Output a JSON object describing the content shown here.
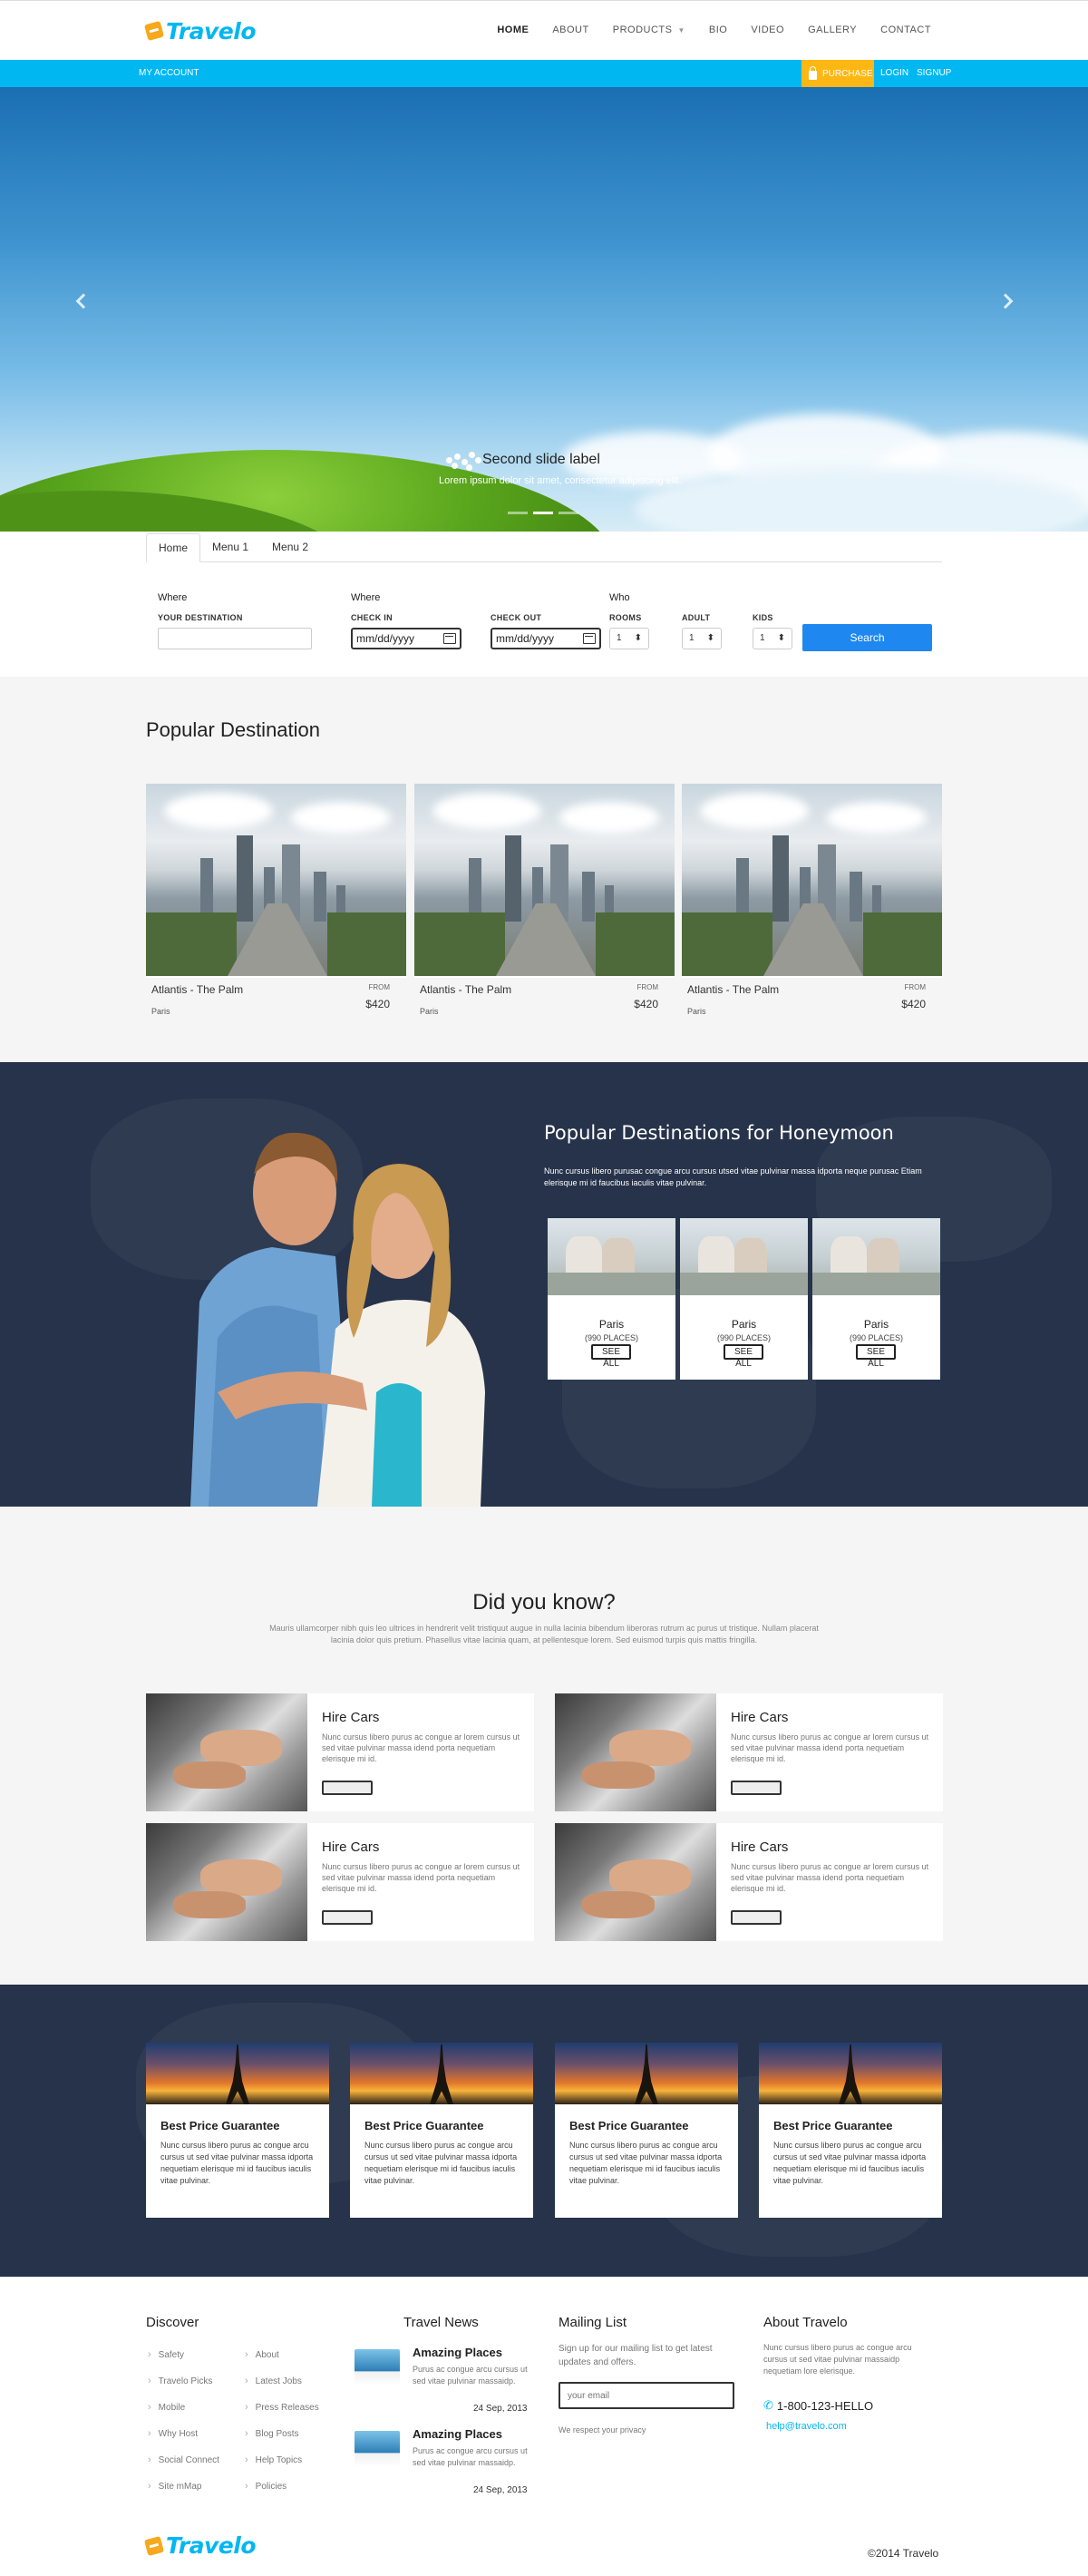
{
  "brand": {
    "name": "Travelo",
    "accent": "#01b7f2",
    "orange": "#fdb714"
  },
  "nav": {
    "items": [
      "HOME",
      "ABOUT",
      "PRODUCTS",
      "BIO",
      "VIDEO",
      "GALLERY",
      "CONTACT"
    ]
  },
  "topbar": {
    "account": "MY ACCOUNT",
    "purchase": "PURCHASE",
    "login": "LOGIN",
    "signup": "SIGNUP"
  },
  "hero": {
    "label": "Second slide label",
    "caption": "Lorem ipsum dolor sit amet, consectetur adipiscing elit.",
    "slides": 3,
    "active_slide": 2
  },
  "tabs": [
    "Home",
    "Menu 1",
    "Menu 2"
  ],
  "search": {
    "where1": "Where",
    "destination_label": "YOUR DESTINATION",
    "where2": "Where",
    "checkin_label": "CHECK IN",
    "checkout_label": "CHECK OUT",
    "date_placeholder": "mm/dd/yyyy",
    "who": "Who",
    "rooms_label": "ROOMS",
    "adult_label": "ADULT",
    "kids_label": "KIDS",
    "rooms": "1",
    "adult": "1",
    "kids": "1",
    "button": "Search"
  },
  "popular": {
    "title": "Popular Destination",
    "cards": [
      {
        "name": "Atlantis - The Palm",
        "from": "FROM",
        "price": "$420",
        "location": "Paris"
      },
      {
        "name": "Atlantis - The Palm",
        "from": "FROM",
        "price": "$420",
        "location": "Paris"
      },
      {
        "name": "Atlantis - The Palm",
        "from": "FROM",
        "price": "$420",
        "location": "Paris"
      }
    ]
  },
  "honeymoon": {
    "title": "Popular Destinations for Honeymoon",
    "description": "Nunc cursus libero purusac congue arcu cursus utsed vitae pulvinar massa idporta neque purusac Etiam elerisque mi id faucibus iaculis vitae pulvinar.",
    "cards": [
      {
        "city": "Paris",
        "places": "(990 PLACES)",
        "button": "SEE ALL"
      },
      {
        "city": "Paris",
        "places": "(990 PLACES)",
        "button": "SEE ALL"
      },
      {
        "city": "Paris",
        "places": "(990 PLACES)",
        "button": "SEE ALL"
      }
    ]
  },
  "didyouknow": {
    "title": "Did you know?",
    "description": "Mauris ullamcorper nibh quis leo ultrices in hendrerit velit tristiquut augue in nulla lacinia bibendum liberoras rutrum ac purus ut tristique. Nullam placerat lacinia dolor quis pretium. Phasellus vitae lacinia quam, at pellentesque lorem. Sed euismod turpis quis mattis fringilla.",
    "items": [
      {
        "title": "Hire Cars",
        "text": "Nunc cursus libero purus ac congue ar lorem cursus ut sed vitae pulvinar massa idend porta nequetiam elerisque mi id."
      },
      {
        "title": "Hire Cars",
        "text": "Nunc cursus libero purus ac congue ar lorem cursus ut sed vitae pulvinar massa idend porta nequetiam elerisque mi id."
      },
      {
        "title": "Hire Cars",
        "text": "Nunc cursus libero purus ac congue ar lorem cursus ut sed vitae pulvinar massa idend porta nequetiam elerisque mi id."
      },
      {
        "title": "Hire Cars",
        "text": "Nunc cursus libero purus ac congue ar lorem cursus ut sed vitae pulvinar massa idend porta nequetiam elerisque mi id."
      }
    ]
  },
  "best": {
    "cards": [
      {
        "title": "Best Price Guarantee",
        "text": "Nunc cursus libero purus ac congue arcu cursus ut sed vitae pulvinar massa idporta nequetiam elerisque mi id faucibus iaculis vitae pulvinar."
      },
      {
        "title": "Best Price Guarantee",
        "text": "Nunc cursus libero purus ac congue arcu cursus ut sed vitae pulvinar massa idporta nequetiam elerisque mi id faucibus iaculis vitae pulvinar."
      },
      {
        "title": "Best Price Guarantee",
        "text": "Nunc cursus libero purus ac congue arcu cursus ut sed vitae pulvinar massa idporta nequetiam elerisque mi id faucibus iaculis vitae pulvinar."
      },
      {
        "title": "Best Price Guarantee",
        "text": "Nunc cursus libero purus ac congue arcu cursus ut sed vitae pulvinar massa idporta nequetiam elerisque mi id faucibus iaculis vitae pulvinar."
      }
    ]
  },
  "footer": {
    "discover": {
      "title": "Discover",
      "col1": [
        "Safety",
        "Travelo Picks",
        "Mobile",
        "Why Host",
        "Social Connect",
        "Site mMap"
      ],
      "col2": [
        "About",
        "Latest Jobs",
        "Press Releases",
        "Blog Posts",
        "Help Topics",
        "Policies"
      ]
    },
    "news": {
      "title": "Travel News",
      "items": [
        {
          "title": "Amazing Places",
          "text": "Purus ac congue arcu cursus ut sed vitae pulvinar massaidp.",
          "date": "24 Sep, 2013"
        },
        {
          "title": "Amazing Places",
          "text": "Purus ac congue arcu cursus ut sed vitae pulvinar massaidp.",
          "date": "24 Sep, 2013"
        }
      ]
    },
    "mailing": {
      "title": "Mailing List",
      "text": "Sign up for our mailing list to get latest updates and offers.",
      "placeholder": "your email",
      "privacy": "We respect your privacy"
    },
    "about": {
      "title": "About Travelo",
      "text": "Nunc cursus libero purus ac congue arcu cursus ut sed vitae pulvinar massaidp nequetiam lore elerisque.",
      "phone": "1-800-123-HELLO",
      "email": "help@travelo.com"
    },
    "copyright": "©2014 Travelo"
  }
}
